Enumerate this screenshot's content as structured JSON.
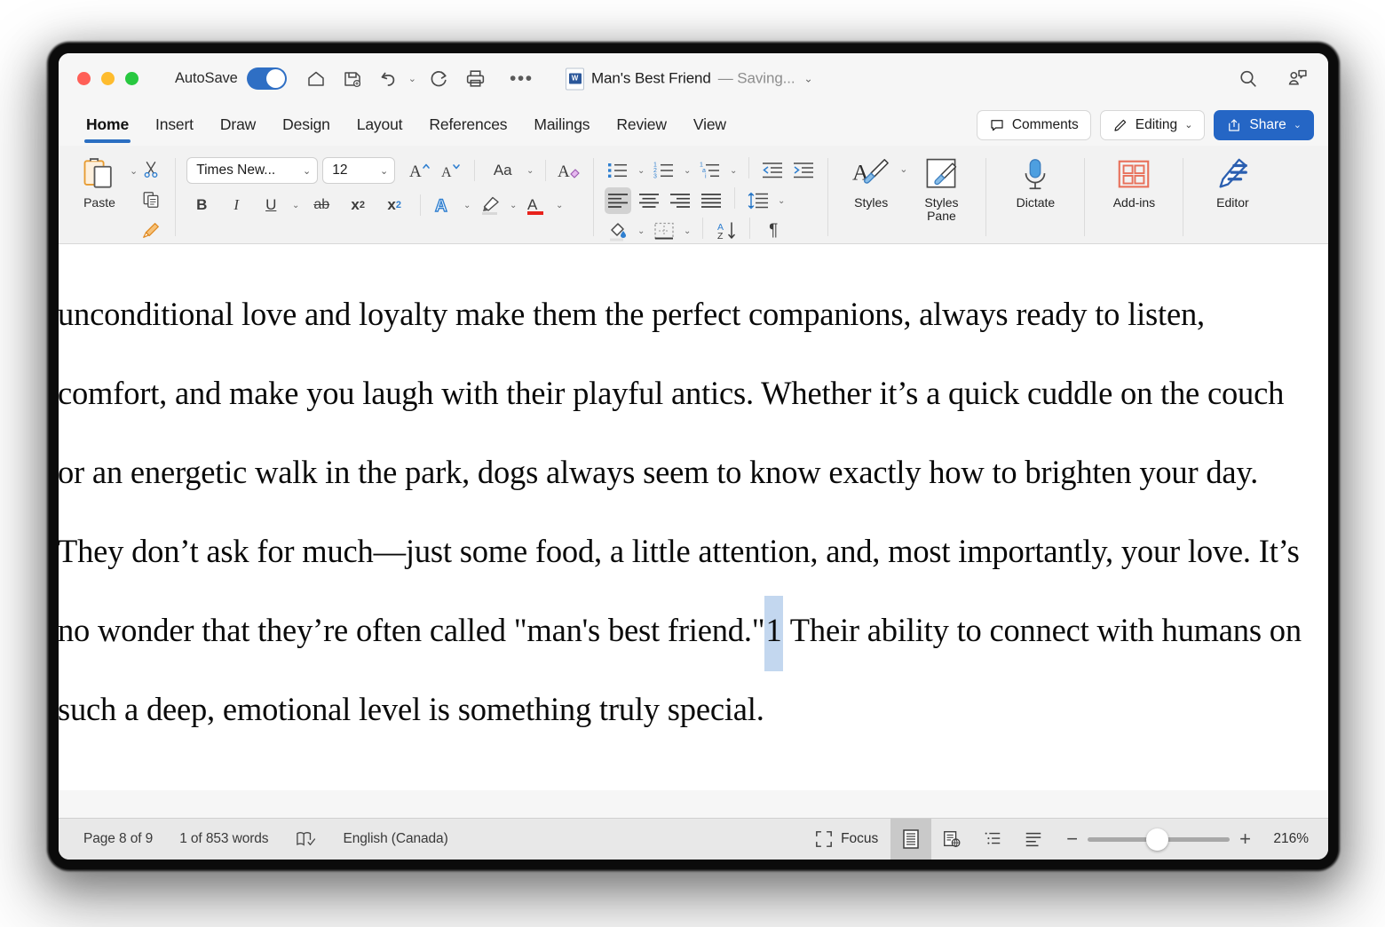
{
  "titlebar": {
    "autosave_label": "AutoSave",
    "autosave_on": true,
    "doc_title": "Man's Best Friend",
    "doc_status": "— Saving...",
    "chevron": "⌄",
    "more_dots": "•••",
    "icons": {
      "home": "home-icon",
      "save": "save-icon",
      "undo": "undo-icon",
      "redo": "redo-icon",
      "print": "print-icon",
      "search": "search-icon",
      "collaborators": "collaborators-icon"
    }
  },
  "tabs": [
    {
      "label": "Home",
      "active": true
    },
    {
      "label": "Insert",
      "active": false
    },
    {
      "label": "Draw",
      "active": false
    },
    {
      "label": "Design",
      "active": false
    },
    {
      "label": "Layout",
      "active": false
    },
    {
      "label": "References",
      "active": false
    },
    {
      "label": "Mailings",
      "active": false
    },
    {
      "label": "Review",
      "active": false
    },
    {
      "label": "View",
      "active": false
    }
  ],
  "tab_actions": {
    "comments_label": "Comments",
    "editing_label": "Editing",
    "share_label": "Share",
    "chevron": "⌄",
    "share_color": "#2566c5"
  },
  "ribbon": {
    "paste_label": "Paste",
    "paste_chevron": "⌄",
    "cut_name": "cut-icon",
    "copy_name": "copy-icon",
    "format_painter_name": "format-painter-icon",
    "font_name": "Times New...",
    "font_size": "12",
    "chevron": "⌄",
    "grow_font": "A",
    "shrink_font": "A",
    "change_case": "Aa",
    "clear_formatting": "A",
    "bold": "B",
    "italic": "I",
    "underline": "U",
    "strikethrough": "ab",
    "subscript": "x",
    "subscript_sub": "2",
    "superscript": "x",
    "superscript_sup": "2",
    "text_effects": "A",
    "highlight": "highlighter-icon",
    "font_color": "A",
    "styles_label": "Styles",
    "styles_pane_label": "Styles\nPane",
    "styles_pane_line1": "Styles",
    "styles_pane_line2": "Pane",
    "dictate_label": "Dictate",
    "addins_label": "Add-ins",
    "editor_label": "Editor"
  },
  "document": {
    "lines": [
      {
        "text": "unconditional love and loyalty make them the perfect companions, always ready to listen,"
      },
      {
        "text": "comfort, and make you laugh with their playful antics. Whether it’s a quick cuddle on the couch"
      },
      {
        "text": "or an energetic walk in the park, dogs always seem to know exactly how to brighten your day."
      },
      {
        "text": "They don’t ask for much—just some food, a little attention, and, most importantly, your love. It’s"
      },
      {
        "text": "no wonder that they’re often called \"man's best friend.\"",
        "selected": "1",
        "after": " Their ability to connect with humans on"
      },
      {
        "text": "such a deep, emotional level is something truly special."
      }
    ],
    "selection_color": "#c3d7ef",
    "font": "Times New Roman"
  },
  "statusbar": {
    "page": "Page 8 of 9",
    "words": "1 of 853 words",
    "proofing_icon": "proofing-icon",
    "language": "English (Canada)",
    "focus_label": "Focus",
    "views": [
      {
        "name": "print-layout-view",
        "active": true
      },
      {
        "name": "web-layout-view",
        "active": false
      },
      {
        "name": "outline-view",
        "active": false
      },
      {
        "name": "draft-view",
        "active": false
      }
    ],
    "zoom_minus": "−",
    "zoom_plus": "+",
    "zoom_value": "216%"
  }
}
